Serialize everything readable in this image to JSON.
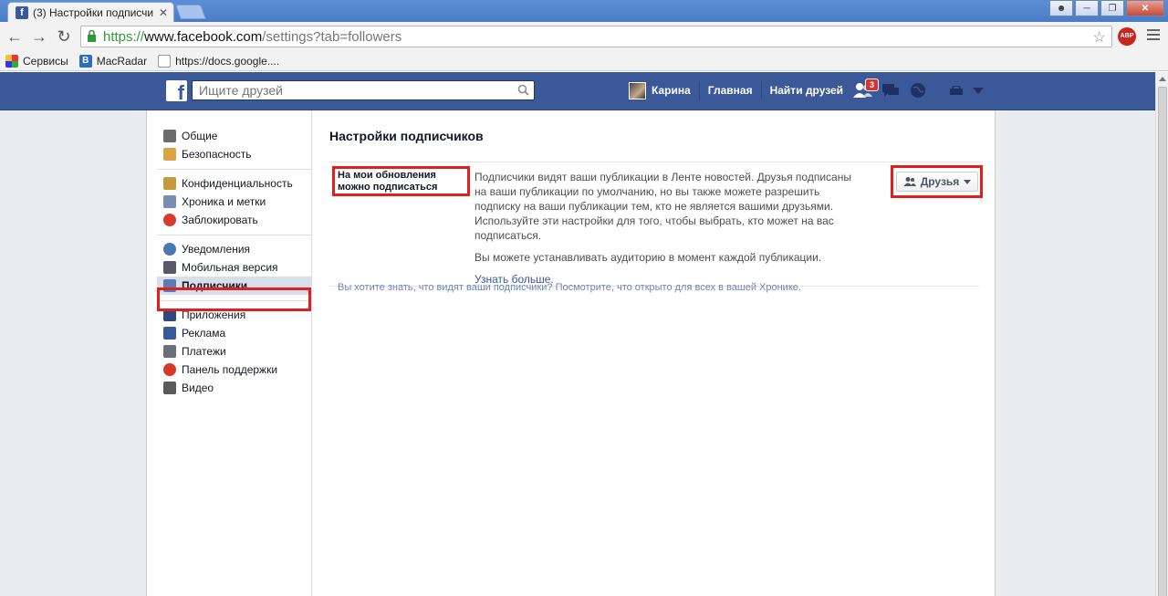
{
  "browser": {
    "tab_title": "(3) Настройки подписчи",
    "tab_favicon": "f",
    "url_https": "https://",
    "url_domain": "www.facebook.com",
    "url_path": "/settings?tab=followers",
    "abp_label": "ABP",
    "bookmarks": [
      {
        "label": "Сервисы",
        "icon": "apps-icon"
      },
      {
        "label": "MacRadar ",
        "icon": "macradar-icon"
      },
      {
        "label": "https://docs.google....",
        "icon": "doc-icon"
      }
    ]
  },
  "fb_header": {
    "logo": "f",
    "search_placeholder": "Ищите друзей",
    "user_name": "Карина",
    "home_label": "Главная",
    "find_friends_label": "Найти друзей",
    "friend_requests_count": "3"
  },
  "sidebar": {
    "groups": [
      [
        {
          "label": "Общие",
          "icon": "gears-icon",
          "color": "#6b6b6b"
        },
        {
          "label": "Безопасность",
          "icon": "badge-icon",
          "color": "#d9a441"
        }
      ],
      [
        {
          "label": "Конфиденциальность",
          "icon": "padlock-icon",
          "color": "#c59a3c"
        },
        {
          "label": "Хроника и метки",
          "icon": "timeline-icon",
          "color": "#7a8db3"
        },
        {
          "label": "Заблокировать",
          "icon": "block-icon",
          "color": "#d63b2f"
        }
      ],
      [
        {
          "label": "Уведомления",
          "icon": "globe-icon",
          "color": "#4a78b5"
        },
        {
          "label": "Мобильная версия",
          "icon": "phone-icon",
          "color": "#555a66"
        },
        {
          "label": "Подписчики",
          "icon": "rss-icon",
          "color": "#5b7bb2",
          "active": true
        }
      ],
      [
        {
          "label": "Приложения",
          "icon": "apps-grid-icon",
          "color": "#2c4a7d"
        },
        {
          "label": "Реклама",
          "icon": "ads-icon",
          "color": "#3b5998"
        },
        {
          "label": "Платежи",
          "icon": "card-icon",
          "color": "#6a6f78"
        },
        {
          "label": "Панель поддержки",
          "icon": "lifebuoy-icon",
          "color": "#d6382b"
        },
        {
          "label": "Видео",
          "icon": "film-icon",
          "color": "#5a5a5a"
        }
      ]
    ]
  },
  "main": {
    "title": "Настройки подписчиков",
    "setting_label": "На мои обновления можно подписаться",
    "setting_desc_1": "Подписчики видят ваши публикации в Ленте новостей. Друзья подписаны на ваши публикации по умолчанию, но вы также можете разрешить подписку на ваши публикации тем, кто не является вашими друзьями. Используйте эти настройки для того, чтобы выбрать, кто может на вас подписаться.",
    "setting_desc_2": "Вы можете устанавливать аудиторию в момент каждой публикации.",
    "learn_more": "Узнать больше.",
    "audience_button": "Друзья",
    "footer_note": "Вы хотите знать, что видят ваши подписчики? Посмотрите, что открыто для всех в вашей Хронике."
  },
  "colors": {
    "fb_blue": "#3b5998",
    "highlight_red": "#e0201c"
  }
}
